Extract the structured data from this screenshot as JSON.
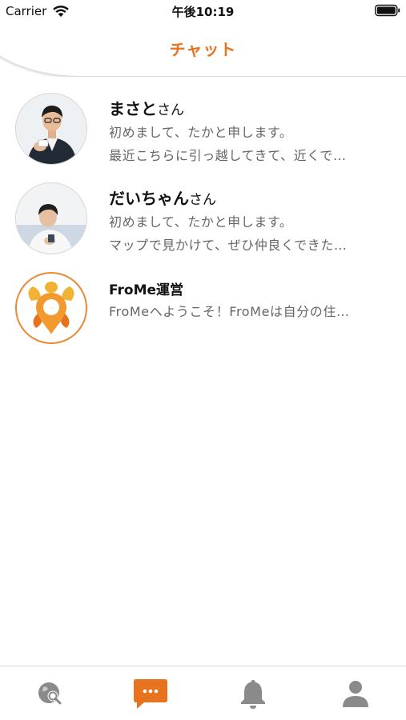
{
  "status_bar": {
    "carrier": "Carrier",
    "time": "午後10:19"
  },
  "header": {
    "title": "チャット"
  },
  "chats": [
    {
      "name": "まさと",
      "suffix": "さん",
      "line1": "初めまして、たかと申します。",
      "line2": "最近こちらに引っ越してきて、近くで…",
      "avatar": "person-photo-avatar"
    },
    {
      "name": "だいちゃん",
      "suffix": "さん",
      "line1": "初めまして、たかと申します。",
      "line2": "マップで見かけて、ぜひ仲良くできた…",
      "avatar": "person-photo-avatar"
    },
    {
      "name": "FroMe運営",
      "suffix": "",
      "line1": "FroMeへようこそ！FroMeは自分の住…",
      "avatar": "frome-turtle-logo"
    }
  ],
  "tab_bar": {
    "tabs": [
      "map-search-icon",
      "chat-bubble-icon",
      "bell-icon",
      "person-icon"
    ],
    "active_index": 1
  },
  "colors": {
    "accent": "#e8731e",
    "tab_inactive": "#8a8a8a",
    "logo_yellow": "#f2b233",
    "logo_orange": "#e8731e"
  }
}
